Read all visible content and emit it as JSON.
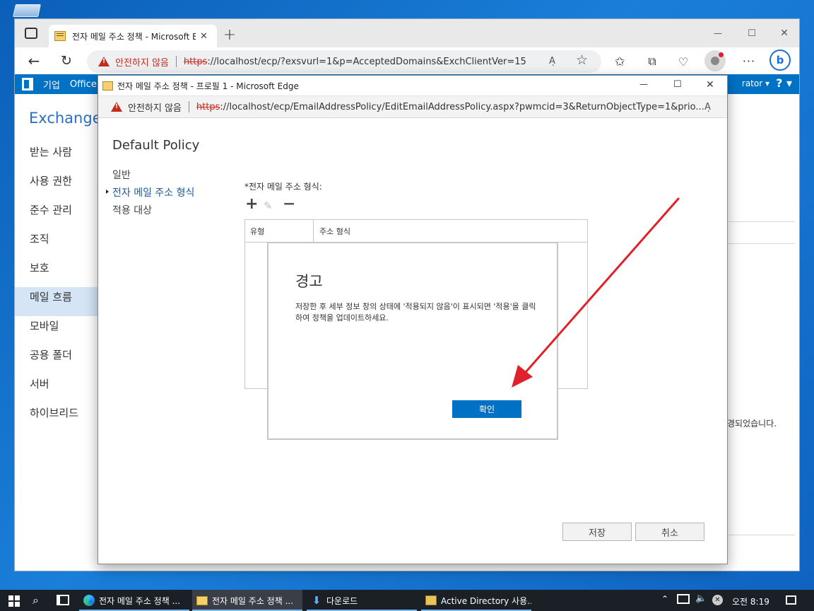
{
  "colors": {
    "accent": "#0072c6",
    "warning": "#c42b1c",
    "arrow": "#e0202a"
  },
  "browser": {
    "tab_title": "전자 메일 주소 정책 - Microsoft Edge",
    "tab_close": "✕",
    "new_tab": "+",
    "insecure_label": "안전하지 않음",
    "url_scheme": "https",
    "url_rest": "://localhost/ecp/?exsvurl=1&p=AcceptedDomains&ExchClientVer=15",
    "read_aloud_icon": "A̅",
    "minimize": "—",
    "maximize": "☐",
    "close": "✕"
  },
  "exchange": {
    "topbar_enterprise": "기업",
    "topbar_office": "Office",
    "admin_label": "rator ▾",
    "help_label": "? ▾",
    "title": "Exchange",
    "nav": [
      "받는 사람",
      "사용 권한",
      "준수 관리",
      "조직",
      "보호",
      "메일 흐름",
      "모바일",
      "공용 폴더",
      "서버",
      "하이브리드"
    ],
    "right_text": "경되었습니다."
  },
  "popup": {
    "window_title": "전자 메일 주소 정책 - 프로필 1 - Microsoft Edge",
    "insecure_label": "안전하지 않음",
    "url_scheme": "https",
    "url_rest": "://localhost/ecp/EmailAddressPolicy/EditEmailAddressPolicy.aspx?pwmcid=3&ReturnObjectType=1&prio...",
    "policy_name": "Default Policy",
    "side_nav": [
      "일반",
      "전자 메일 주소 형식",
      "적용 대상"
    ],
    "format_label": "*전자 메일 주소 형식:",
    "grid_cols": [
      "유형",
      "주소 형식"
    ],
    "save_label": "저장",
    "cancel_label": "취소"
  },
  "dialog": {
    "title": "경고",
    "message": "저장한 후 세부 정보 창의 상태에 '적용되지 않음'이 표시되면 '적용'을 클릭하여 정책을 업데이트하세요.",
    "ok_label": "확인"
  },
  "taskbar": {
    "items": [
      "전자 메일 주소 정책 ...",
      "전자 메일 주소 정책 ...",
      "다운로드",
      "Active Directory 사용..."
    ],
    "time": "오전 8:19"
  }
}
